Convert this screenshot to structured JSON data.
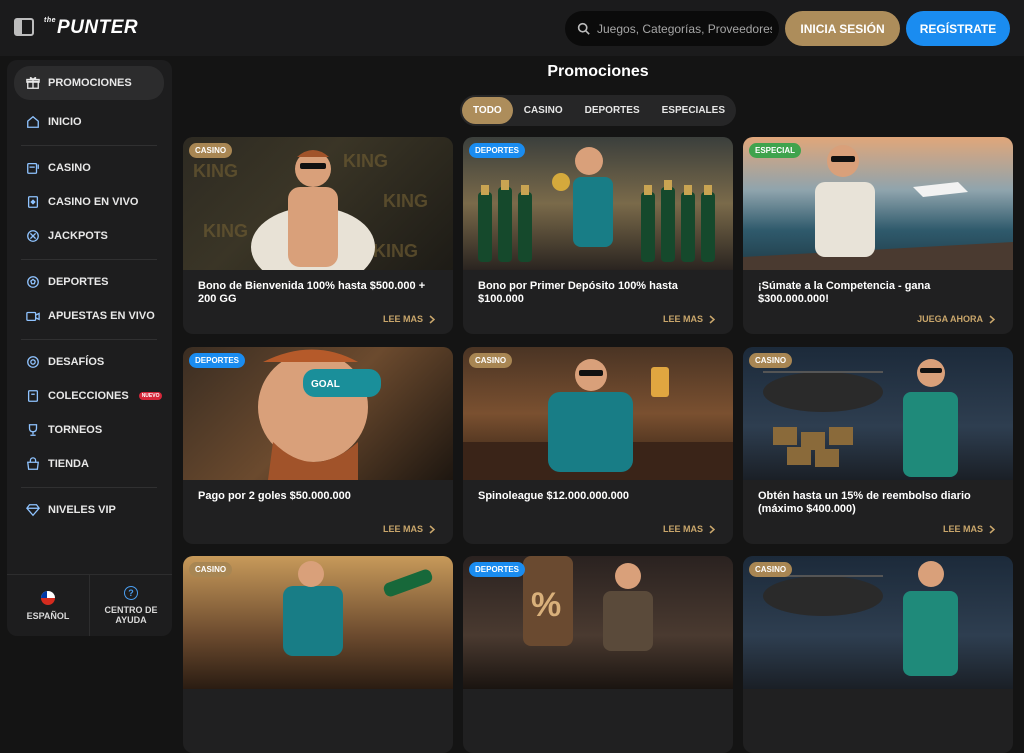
{
  "header": {
    "logo_text": "PUNTER",
    "logo_prefix": "the",
    "search_placeholder": "Juegos, Categorías, Proveedores",
    "login_label": "INICIA SESIÓN",
    "register_label": "REGÍSTRATE"
  },
  "sidebar": {
    "items": [
      {
        "label": "PROMOCIONES",
        "icon": "gift-icon"
      },
      {
        "label": "INICIO",
        "icon": "home-icon"
      },
      {
        "label": "CASINO",
        "icon": "slot-machine-icon"
      },
      {
        "label": "CASINO EN VIVO",
        "icon": "cards-icon"
      },
      {
        "label": "JACKPOTS",
        "icon": "jackpot-icon"
      },
      {
        "label": "DEPORTES",
        "icon": "soccer-ball-icon"
      },
      {
        "label": "APUESTAS EN VIVO",
        "icon": "live-tv-icon"
      },
      {
        "label": "DESAFÍOS",
        "icon": "challenge-icon"
      },
      {
        "label": "COLECCIONES",
        "icon": "collection-icon",
        "badge": "NUEVO"
      },
      {
        "label": "TORNEOS",
        "icon": "trophy-icon"
      },
      {
        "label": "TIENDA",
        "icon": "shop-icon"
      },
      {
        "label": "NIVELES VIP",
        "icon": "diamond-icon"
      }
    ],
    "footer": {
      "language_label": "ESPAÑOL",
      "help_label": "CENTRO DE AYUDA",
      "help_glyph": "?"
    }
  },
  "main": {
    "title": "Promociones",
    "tabs": [
      "TODO",
      "CASINO",
      "DEPORTES",
      "ESPECIALES"
    ],
    "active_tab": "TODO",
    "cards": [
      {
        "tag": "CASINO",
        "title": "Bono de Bienvenida 100% hasta $500.000 + 200 GG",
        "link": "LEE MAS"
      },
      {
        "tag": "DEPORTES",
        "title": "Bono por Primer Depósito 100% hasta $100.000",
        "link": "LEE MAS"
      },
      {
        "tag": "ESPECIAL",
        "title": "¡Súmate a la Competencia - gana $300.000.000!",
        "link": "JUEGA AHORA"
      },
      {
        "tag": "DEPORTES",
        "title": "Pago por 2 goles $50.000.000",
        "link": "LEE MAS"
      },
      {
        "tag": "CASINO",
        "title": "Spinoleague $12.000.000.000",
        "link": "LEE MAS"
      },
      {
        "tag": "CASINO",
        "title": "Obtén hasta un 15% de reembolso diario (máximo $400.000)",
        "link": "LEE MAS"
      },
      {
        "tag": "CASINO",
        "title": "",
        "link": ""
      },
      {
        "tag": "DEPORTES",
        "title": "",
        "link": ""
      },
      {
        "tag": "CASINO",
        "title": "",
        "link": ""
      }
    ]
  },
  "colors": {
    "casino_tag": "#a88653",
    "deportes_tag": "#1a8cf0",
    "especial_tag": "#3fa34d",
    "accent_gold": "#ad8d5b",
    "accent_blue": "#1a8cf0"
  }
}
